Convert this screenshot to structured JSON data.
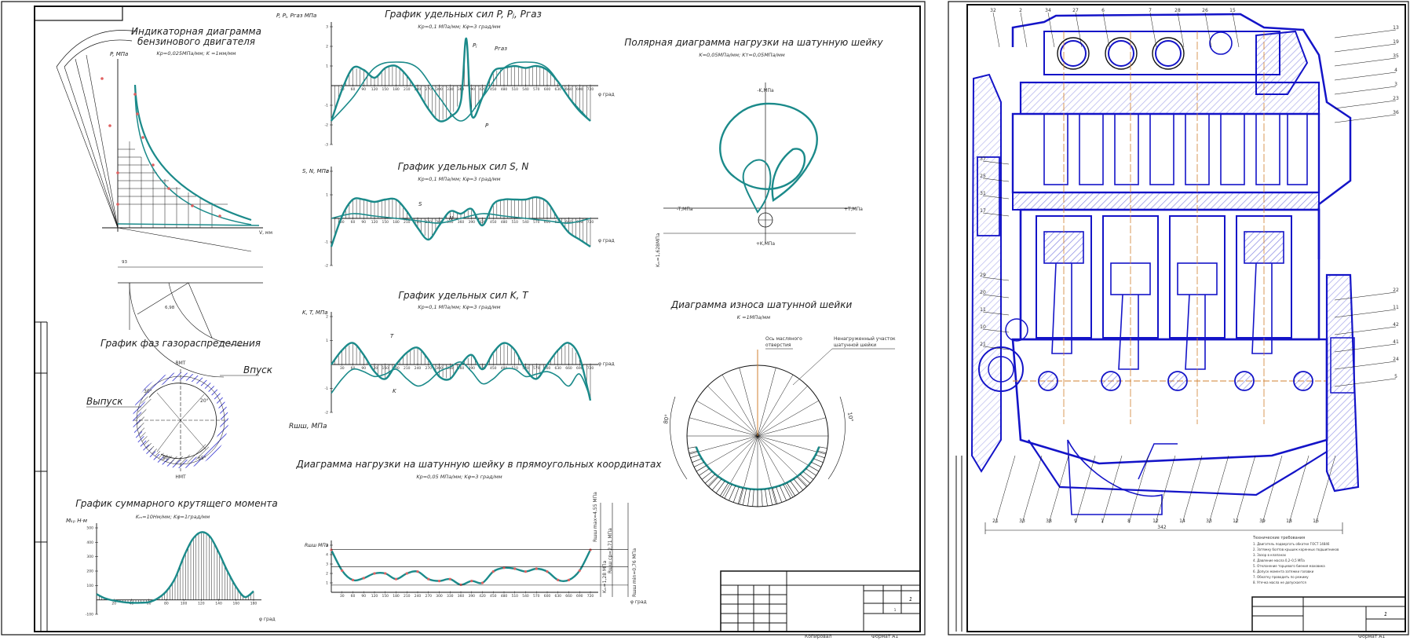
{
  "sheet_left": {
    "indicator": {
      "title_line1": "Индикаторная диаграмма",
      "title_line2": "бензинового двигателя",
      "scale": "Kp=0,025МПа/мм; K =1мм/мм",
      "ylabel": "P, МПа",
      "xlabel": "V, мм"
    },
    "gas_dist": {
      "title": "График фаз газораспределения",
      "top_label": "ВМТ",
      "bottom_label": "НМТ",
      "intake": "Впуск",
      "exhaust": "Выпуск",
      "angle_a": "30°",
      "angle_b": "50°",
      "angle_c": "20°",
      "angle_d": "65°"
    },
    "torque": {
      "title": "График суммарного крутящего момента",
      "scale": "Kₘ=10Нм/мм; Kφ=1град/мм",
      "ylabel": "Mₖₚ Н·м",
      "xlabel": "φ град"
    },
    "forces_p": {
      "title": "График удельных сил P, Pⱼ, Pгаз",
      "scale": "Kp=0,1 МПа/мм; Kφ=3 град/мм",
      "ylabel": "P, Pⱼ, Pгаз МПа",
      "xlabel": "φ град",
      "label_pj": "Pⱼ",
      "label_pgas": "Pгаз",
      "label_p": "P"
    },
    "forces_sn": {
      "title": "График удельных сил S, N",
      "scale": "Kp=0,1 МПа/мм; Kφ=3 град/мм",
      "ylabel": "S, N, МПа",
      "xlabel": "φ град",
      "label_s": "S",
      "label_n": "N"
    },
    "forces_kt": {
      "title": "График удельных сил K, T",
      "scale": "Kp=0,1 МПа/мм; Kφ=3 град/мм",
      "ylabel": "K, T, МПа",
      "xlabel": "φ град",
      "label_t": "T",
      "label_k": "K",
      "rshsh_label": "Rшш, МПа"
    },
    "load_rect": {
      "title": "Диаграмма нагрузки на шатунную шейку в прямоугольных координатах",
      "scale": "Kp=0,05 МПа/мм; Kφ=3 град/мм",
      "ylabel": "Rшш МПа",
      "xlabel": "φ град",
      "max_label": "Rшш max=4,55 МПа",
      "avg_label": "Rшш ср=2,71 МПа",
      "min_label": "Rшш min=0,76 МПа",
      "kdelta": "Kₘ=1,28 МПа"
    },
    "polar": {
      "title": "Полярная диаграмма нагрузки на шатунную шейку",
      "scale": "K=0,05МПа/мм; Kт=0,05МПа/мм",
      "top_label": "-K,МПа",
      "bottom_label": "+K,МПа",
      "left_label": "-T,МПа",
      "right_label": "+T,МПа",
      "kdelta_v": "Kₘ=1,628МПа"
    },
    "wear": {
      "title": "Диаграмма износа шатунной шейки",
      "scale": "K =1МПа/мм",
      "oil_label_1": "Ось масляного",
      "oil_label_2": "отверстия",
      "unloaded_1": "Ненагруженный участок",
      "unloaded_2": "шатунной шейки",
      "angle_left": "80°",
      "angle_right": "10°"
    },
    "title_block": {
      "sheet_no": "1",
      "sheets": "1",
      "copied": "Копировал",
      "format": "Формат А1"
    }
  },
  "sheet_right": {
    "callouts_top": [
      "32",
      "2",
      "34",
      "27",
      "6",
      "7",
      "28",
      "26",
      "15"
    ],
    "callouts_left": [
      "37",
      "25",
      "31",
      "17",
      "29",
      "20",
      "11",
      "10",
      "21"
    ],
    "callouts_right": [
      "13",
      "19",
      "35",
      "4",
      "3",
      "23",
      "36",
      "22",
      "11",
      "42",
      "41",
      "24",
      "5"
    ],
    "callouts_bottom": [
      "21",
      "33",
      "38",
      "9",
      "1",
      "8",
      "12",
      "14",
      "33",
      "12",
      "39",
      "18",
      "16"
    ],
    "width_dim": "342",
    "notes_title": "Технические требования",
    "notes": [
      "1. Двигатель подвергать обкатке ГОСТ 14846",
      "2. Затяжку болтов крышек коренных подшипников",
      "3. Зазор в клапанах",
      "4. Давление масла 0,2–0,5 МПа",
      "5. Отклонение торцевого биения маховика",
      "6. Допуск момента затяжки головки",
      "7. Обкатку проводить по режиму",
      "8. Утечка масла не допускается"
    ],
    "title_block": {
      "format": "Формат А1",
      "sheet_no": "1"
    }
  },
  "colors": {
    "curve": "#1b8a8a",
    "line": "#111111",
    "engine_blue": "#1414c8",
    "hatch": "#333333",
    "point": "#e06060"
  },
  "chart_data": [
    {
      "type": "line",
      "title": "График удельных сил P, Pⱼ, Pгаз",
      "xlabel": "φ град",
      "ylabel": "P, Pⱼ, Pгаз МПа",
      "xlim": [
        0,
        720
      ],
      "ylim": [
        -3,
        3
      ],
      "series": [
        {
          "name": "P",
          "x": [
            0,
            30,
            60,
            90,
            120,
            150,
            180,
            210,
            240,
            270,
            300,
            330,
            360,
            375,
            390,
            420,
            450,
            480,
            510,
            540,
            570,
            600,
            630,
            660,
            690,
            720
          ],
          "y": [
            -1.8,
            -0.2,
            0.9,
            0.8,
            0.4,
            0.9,
            1.0,
            0.5,
            -0.3,
            -1.2,
            -1.8,
            -1.6,
            -0.8,
            2.4,
            -1.5,
            -0.6,
            0.7,
            0.9,
            1.0,
            0.9,
            1.0,
            0.8,
            0.2,
            -0.6,
            -1.3,
            -1.8
          ]
        },
        {
          "name": "Pⱼ",
          "x": [
            0,
            60,
            120,
            180,
            240,
            300,
            360,
            420,
            480,
            540,
            600,
            660,
            720
          ],
          "y": [
            -1.8,
            -0.6,
            0.9,
            1.2,
            0.9,
            -0.6,
            -1.8,
            -0.6,
            0.9,
            1.2,
            0.9,
            -0.6,
            -1.8
          ]
        }
      ]
    },
    {
      "type": "line",
      "title": "График удельных сил S, N",
      "xlabel": "φ град",
      "ylabel": "S, N, МПа",
      "xlim": [
        0,
        720
      ],
      "ylim": [
        -2,
        2
      ],
      "series": [
        {
          "name": "S",
          "x": [
            0,
            30,
            60,
            90,
            120,
            150,
            180,
            210,
            240,
            270,
            300,
            330,
            360,
            390,
            420,
            450,
            480,
            510,
            540,
            570,
            600,
            630,
            660,
            690,
            720
          ],
          "y": [
            -1.2,
            0.1,
            0.8,
            0.8,
            0.7,
            0.8,
            0.8,
            0.3,
            -0.4,
            -0.9,
            -0.3,
            0.3,
            0.2,
            0.4,
            -0.3,
            0.6,
            0.8,
            0.8,
            0.8,
            0.9,
            0.7,
            0.0,
            -0.6,
            -0.9,
            -1.2
          ]
        },
        {
          "name": "N",
          "x": [
            0,
            60,
            120,
            180,
            240,
            300,
            360,
            420,
            480,
            540,
            600,
            660,
            720
          ],
          "y": [
            0,
            0.2,
            0.1,
            0,
            -0.1,
            -0.2,
            0,
            0.2,
            0.1,
            0,
            -0.1,
            -0.2,
            0
          ]
        }
      ]
    },
    {
      "type": "line",
      "title": "График удельных сил K, T",
      "xlabel": "φ град",
      "ylabel": "K, T, МПа",
      "xlim": [
        0,
        720
      ],
      "ylim": [
        -2,
        2
      ],
      "series": [
        {
          "name": "T",
          "x": [
            0,
            30,
            60,
            90,
            120,
            150,
            180,
            210,
            240,
            270,
            300,
            330,
            360,
            390,
            420,
            450,
            480,
            510,
            540,
            570,
            600,
            630,
            660,
            690,
            720
          ],
          "y": [
            0,
            0.6,
            0.9,
            0.4,
            -0.3,
            -0.6,
            0,
            0.5,
            0.7,
            0.2,
            -0.5,
            -0.6,
            0,
            0.4,
            -0.2,
            0.5,
            0.9,
            0.6,
            -0.2,
            -0.6,
            0,
            0.6,
            0.9,
            0.3,
            -1.5
          ]
        },
        {
          "name": "K",
          "x": [
            0,
            30,
            60,
            90,
            120,
            150,
            180,
            210,
            240,
            270,
            300,
            330,
            360,
            390,
            420,
            450,
            480,
            510,
            540,
            570,
            600,
            630,
            660,
            690,
            720
          ],
          "y": [
            -1.2,
            -0.6,
            -0.2,
            -0.3,
            -0.5,
            -0.4,
            -0.2,
            -0.6,
            -0.9,
            -0.7,
            -0.3,
            -0.1,
            0.1,
            -0.3,
            -0.8,
            -0.6,
            -0.2,
            -0.2,
            -0.5,
            -0.4,
            -0.3,
            -0.5,
            -0.9,
            -0.4,
            -1.4
          ]
        }
      ]
    },
    {
      "type": "line",
      "title": "График суммарного крутящего момента",
      "xlabel": "φ град",
      "ylabel": "Mₖₚ Н·м",
      "xlim": [
        0,
        180
      ],
      "ylim": [
        -100,
        500
      ],
      "series": [
        {
          "name": "Mkp",
          "x": [
            0,
            10,
            20,
            30,
            40,
            50,
            60,
            70,
            80,
            90,
            100,
            110,
            120,
            130,
            140,
            150,
            160,
            170,
            180
          ],
          "y": [
            40,
            10,
            -5,
            -15,
            -20,
            -20,
            -15,
            10,
            60,
            150,
            300,
            420,
            470,
            440,
            330,
            200,
            90,
            20,
            60
          ]
        }
      ]
    },
    {
      "type": "line",
      "title": "Диаграмма нагрузки на шатунную шейку в прямоугольных координатах",
      "xlabel": "φ град",
      "ylabel": "Rшш МПа",
      "xlim": [
        0,
        720
      ],
      "ylim": [
        0,
        5
      ],
      "series": [
        {
          "name": "Rшш",
          "x": [
            0,
            30,
            60,
            90,
            120,
            150,
            180,
            210,
            240,
            270,
            300,
            330,
            360,
            390,
            420,
            450,
            480,
            510,
            540,
            570,
            600,
            630,
            660,
            690,
            720
          ],
          "y": [
            4.5,
            2.3,
            1.3,
            1.5,
            2.0,
            2.0,
            1.4,
            2.0,
            2.2,
            1.4,
            1.2,
            1.4,
            0.8,
            1.2,
            1.0,
            2.2,
            2.6,
            2.5,
            2.2,
            2.5,
            2.2,
            1.3,
            1.3,
            2.3,
            4.5
          ]
        }
      ]
    }
  ]
}
